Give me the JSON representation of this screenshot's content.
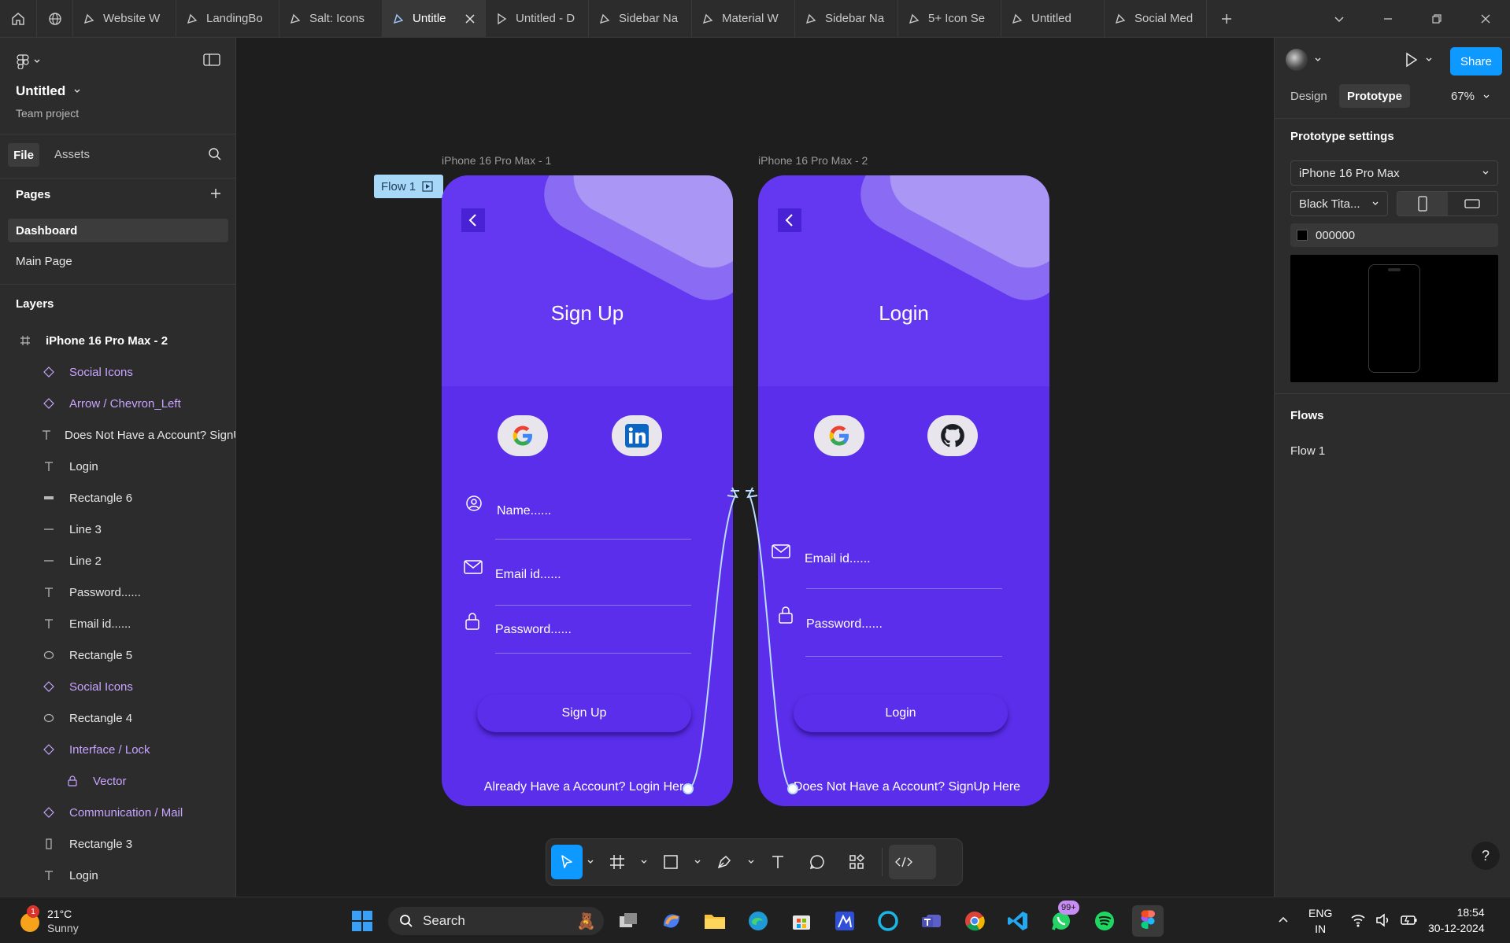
{
  "tabs": [
    {
      "label": "Website W",
      "active": false
    },
    {
      "label": "LandingBo",
      "active": false
    },
    {
      "label": "Salt: Icons",
      "active": false
    },
    {
      "label": "Untitle",
      "active": true
    },
    {
      "label": "Untitled - D",
      "active": false
    },
    {
      "label": "Sidebar Na",
      "active": false
    },
    {
      "label": "Material W",
      "active": false
    },
    {
      "label": "Sidebar Na",
      "active": false
    },
    {
      "label": "5+ Icon Se",
      "active": false
    },
    {
      "label": "Untitled",
      "active": false
    },
    {
      "label": "Social Med",
      "active": false
    }
  ],
  "file": {
    "name": "Untitled",
    "project": "Team project"
  },
  "left_tabs": {
    "file": "File",
    "assets": "Assets"
  },
  "pages": {
    "heading": "Pages",
    "items": [
      {
        "label": "Dashboard",
        "selected": true
      },
      {
        "label": "Main Page",
        "selected": false
      }
    ]
  },
  "layers": {
    "heading": "Layers",
    "root": "iPhone 16 Pro Max - 2",
    "items": [
      {
        "label": "Social Icons",
        "type": "component"
      },
      {
        "label": "Arrow / Chevron_Left",
        "type": "component"
      },
      {
        "label": "Does Not Have a Account? SignUp Here",
        "type": "text"
      },
      {
        "label": "Login",
        "type": "text"
      },
      {
        "label": "Rectangle 6",
        "type": "rect-flat"
      },
      {
        "label": "Line 3",
        "type": "line"
      },
      {
        "label": "Line 2",
        "type": "line"
      },
      {
        "label": "Password......",
        "type": "text"
      },
      {
        "label": "Email id......",
        "type": "text"
      },
      {
        "label": "Rectangle 5",
        "type": "ellipse"
      },
      {
        "label": "Social Icons",
        "type": "component"
      },
      {
        "label": "Rectangle 4",
        "type": "ellipse"
      },
      {
        "label": "Interface / Lock",
        "type": "component"
      },
      {
        "label": "Vector",
        "type": "vector"
      },
      {
        "label": "Communication / Mail",
        "type": "component"
      },
      {
        "label": "Rectangle 3",
        "type": "rect-tall"
      },
      {
        "label": "Login",
        "type": "text"
      }
    ]
  },
  "canvas": {
    "flow_badge": "Flow 1",
    "frame1": {
      "label": "iPhone 16 Pro Max - 1",
      "title": "Sign Up",
      "fields": [
        "Name......",
        "Email id......",
        "Password......"
      ],
      "button": "Sign Up",
      "footer": "Already Have a Account? Login Here",
      "social": [
        "google-icon",
        "linkedin-icon"
      ]
    },
    "frame2": {
      "label": "iPhone 16 Pro Max - 2",
      "title": "Login",
      "fields": [
        "Email id......",
        "Password......"
      ],
      "button": "Login",
      "footer": "Does Not Have a Account? SignUp Here",
      "social": [
        "google-icon",
        "github-icon"
      ]
    }
  },
  "right_panel": {
    "tabs": {
      "design": "Design",
      "prototype": "Prototype"
    },
    "active_tab": "Prototype",
    "zoom": "67%",
    "share": "Share",
    "section_title": "Prototype settings",
    "device": "iPhone 16 Pro Max",
    "model": "Black Tita...",
    "bg_color": "000000",
    "flows_heading": "Flows",
    "flows": [
      "Flow 1"
    ]
  },
  "taskbar": {
    "weather_temp": "21°C",
    "weather_desc": "Sunny",
    "weather_badge": "1",
    "search": "Search",
    "whatsapp_badge": "99+",
    "lang1": "ENG",
    "lang2": "IN",
    "time": "18:54",
    "date": "30-12-2024"
  },
  "colors": {
    "accent": "#0d99ff",
    "phone_bg": "#5a2eea",
    "component_text": "#c8a4ff",
    "flow_badge": "#a8d8f8"
  }
}
